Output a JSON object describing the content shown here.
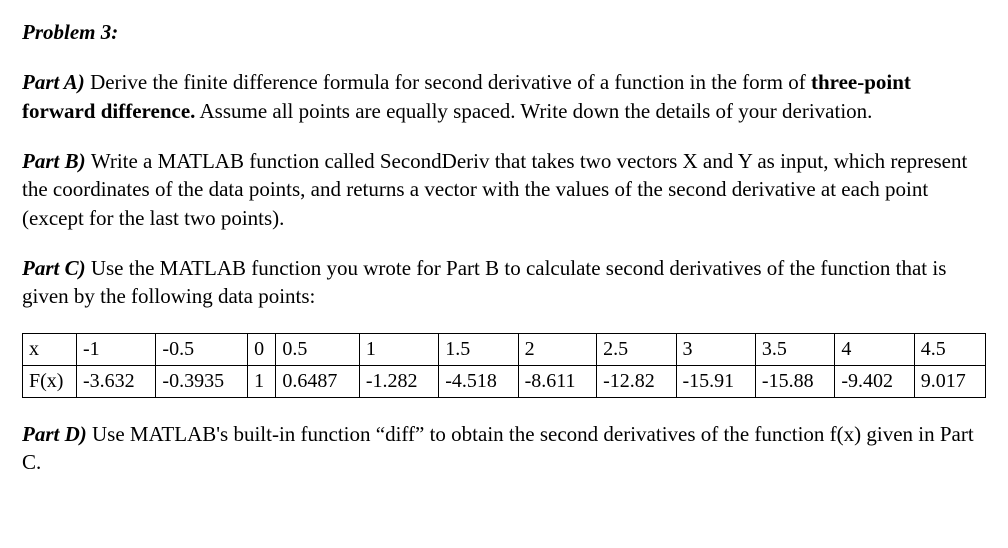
{
  "problem_title": "Problem 3:",
  "partA": {
    "label": "Part A) ",
    "text_before_bold": "Derive the finite difference formula for second derivative of a function in the form of ",
    "bold_text": "three-point forward difference.",
    "text_after_bold": " Assume all points are equally spaced. Write down the details of your derivation."
  },
  "partB": {
    "label": "Part B) ",
    "text": "Write a MATLAB function called SecondDeriv that takes two vectors X and Y as input, which represent the coordinates of the data points, and returns a vector with the values of the second derivative at each point (except for the last two points)."
  },
  "partC": {
    "label": "Part C) ",
    "text": "Use the MATLAB function you wrote for Part B to calculate second derivatives of the function that is given by the following data points:"
  },
  "table": {
    "row_labels": [
      "x",
      "F(x)"
    ],
    "x_values": [
      "-1",
      "-0.5",
      "0",
      "0.5",
      "1",
      "1.5",
      "2",
      "2.5",
      "3",
      "3.5",
      "4",
      "4.5"
    ],
    "fx_values": [
      "-3.632",
      "-0.3935",
      "1",
      "0.6487",
      "-1.282",
      "-4.518",
      "-8.611",
      "-12.82",
      "-15.91",
      "-15.88",
      "-9.402",
      "9.017"
    ]
  },
  "partD": {
    "label": "Part D) ",
    "text": "Use MATLAB's built-in function “diff” to obtain the second derivatives of the function f(x) given in Part C."
  },
  "chart_data": {
    "type": "table",
    "columns": [
      "x",
      "F(x)"
    ],
    "rows": [
      {
        "x": -1,
        "F(x)": -3.632
      },
      {
        "x": -0.5,
        "F(x)": -0.3935
      },
      {
        "x": 0,
        "F(x)": 1
      },
      {
        "x": 0.5,
        "F(x)": 0.6487
      },
      {
        "x": 1,
        "F(x)": -1.282
      },
      {
        "x": 1.5,
        "F(x)": -4.518
      },
      {
        "x": 2,
        "F(x)": -8.611
      },
      {
        "x": 2.5,
        "F(x)": -12.82
      },
      {
        "x": 3,
        "F(x)": -15.91
      },
      {
        "x": 3.5,
        "F(x)": -15.88
      },
      {
        "x": 4,
        "F(x)": -9.402
      },
      {
        "x": 4.5,
        "F(x)": 9.017
      }
    ]
  }
}
